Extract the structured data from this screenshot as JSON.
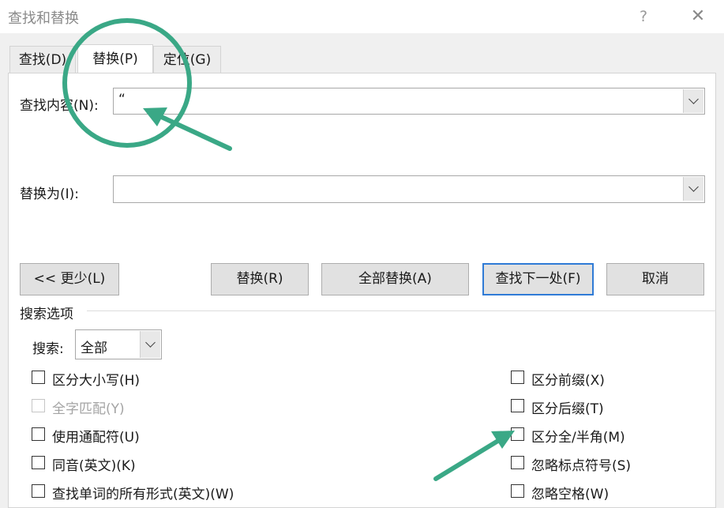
{
  "window": {
    "title": "查找和替换",
    "help": "?",
    "close": "✕"
  },
  "tabs": [
    {
      "label": "查找(D)",
      "active": false
    },
    {
      "label": "替换(P)",
      "active": true
    },
    {
      "label": "定位(G)",
      "active": false
    }
  ],
  "find": {
    "label": "查找内容(N):",
    "value": "“"
  },
  "replace": {
    "label": "替换为(I):",
    "value": ""
  },
  "buttons": {
    "less": "<< 更少(L)",
    "replace": "替换(R)",
    "replace_all": "全部替换(A)",
    "find_next": "查找下一处(F)",
    "cancel": "取消"
  },
  "search_options": {
    "section_label": "搜索选项",
    "search_label": "搜索:",
    "search_value": "全部"
  },
  "options_left": [
    {
      "label": "区分大小写(H)",
      "checked": false,
      "disabled": false
    },
    {
      "label": "全字匹配(Y)",
      "checked": false,
      "disabled": true
    },
    {
      "label": "使用通配符(U)",
      "checked": false,
      "disabled": false
    },
    {
      "label": "同音(英文)(K)",
      "checked": false,
      "disabled": false
    },
    {
      "label": "查找单词的所有形式(英文)(W)",
      "checked": false,
      "disabled": false
    }
  ],
  "options_right": [
    {
      "label": "区分前缀(X)",
      "checked": false,
      "disabled": false
    },
    {
      "label": "区分后缀(T)",
      "checked": false,
      "disabled": false
    },
    {
      "label": "区分全/半角(M)",
      "checked": false,
      "disabled": false
    },
    {
      "label": "忽略标点符号(S)",
      "checked": false,
      "disabled": false
    },
    {
      "label": "忽略空格(W)",
      "checked": false,
      "disabled": false
    }
  ],
  "annotation_color": "#3aa886"
}
